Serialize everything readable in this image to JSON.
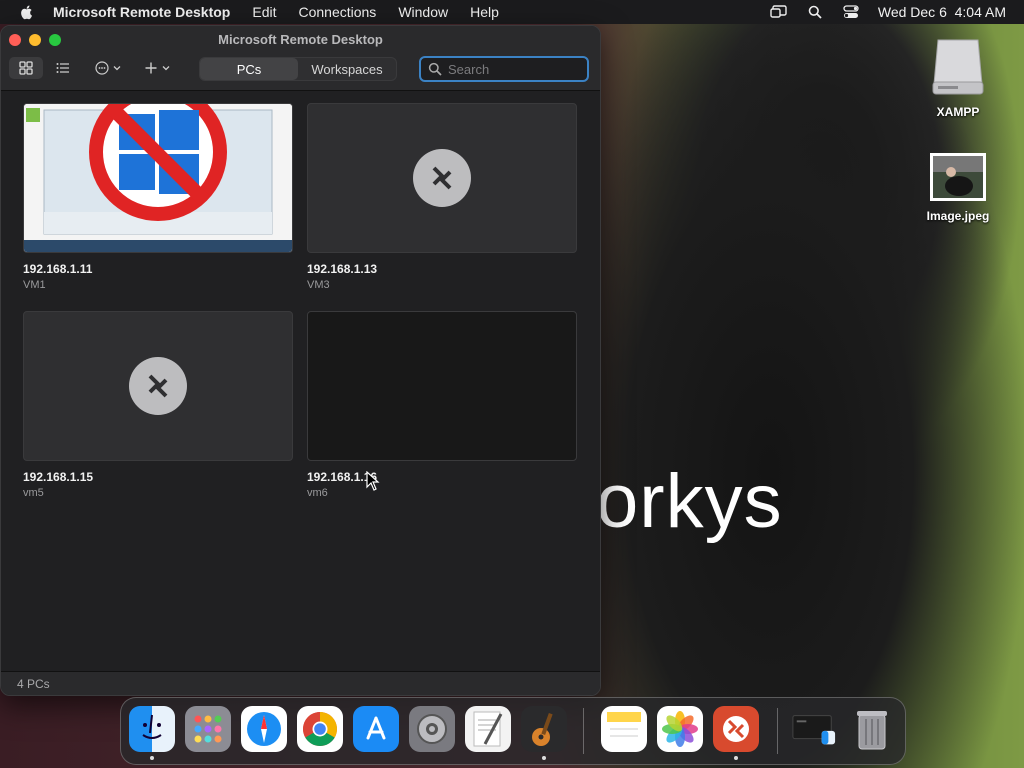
{
  "menubar": {
    "app_name": "Microsoft Remote Desktop",
    "items": [
      "Edit",
      "Connections",
      "Window",
      "Help"
    ],
    "clock": "Wed Dec 6  4:04 AM"
  },
  "desktop": {
    "overlay_text": "orkys",
    "icons": [
      {
        "label": "XAMPP",
        "icon": "drive-icon"
      },
      {
        "label": "Image.jpeg",
        "icon": "image-file-icon"
      }
    ]
  },
  "window": {
    "title": "Microsoft Remote Desktop",
    "segments": [
      "PCs",
      "Workspaces"
    ],
    "active_segment": "PCs",
    "search": {
      "placeholder": "Search",
      "value": ""
    },
    "pcs": [
      {
        "name": "192.168.1.11",
        "sub": "VM1",
        "thumb": "windows-no-sign"
      },
      {
        "name": "192.168.1.13",
        "sub": "VM3",
        "thumb": "remote-desktop-logo"
      },
      {
        "name": "192.168.1.15",
        "sub": "vm5",
        "thumb": "remote-desktop-logo"
      },
      {
        "name": "192.168.1.16",
        "sub": "vm6",
        "thumb": "dark"
      }
    ],
    "status": "4 PCs"
  },
  "dock": {
    "apps": [
      "Finder",
      "Launchpad",
      "Safari",
      "Google Chrome",
      "App Store",
      "System Settings",
      "TextEdit",
      "GarageBand",
      "Notes",
      "Photos",
      "Microsoft Remote Desktop",
      "Screen Sharing",
      "Trash"
    ]
  },
  "colors": {
    "accent": "#3b82c4",
    "close": "#ff5f57",
    "minimize": "#febc2e",
    "maximize": "#28c840"
  }
}
